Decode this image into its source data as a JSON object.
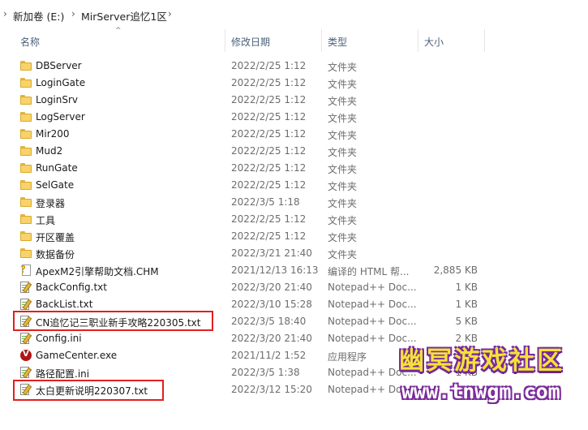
{
  "breadcrumb": {
    "parts": [
      "新加卷 (E:)",
      "MirServer追忆1区"
    ]
  },
  "columns": {
    "name": "名称",
    "date": "修改日期",
    "type": "类型",
    "size": "大小"
  },
  "files": [
    {
      "name": "DBServer",
      "date": "2022/2/25 1:12",
      "type": "文件夹",
      "size": "",
      "icon": "folder-icon"
    },
    {
      "name": "LoginGate",
      "date": "2022/2/25 1:12",
      "type": "文件夹",
      "size": "",
      "icon": "folder-icon"
    },
    {
      "name": "LoginSrv",
      "date": "2022/2/25 1:12",
      "type": "文件夹",
      "size": "",
      "icon": "folder-icon"
    },
    {
      "name": "LogServer",
      "date": "2022/2/25 1:12",
      "type": "文件夹",
      "size": "",
      "icon": "folder-icon"
    },
    {
      "name": "Mir200",
      "date": "2022/2/25 1:12",
      "type": "文件夹",
      "size": "",
      "icon": "folder-icon"
    },
    {
      "name": "Mud2",
      "date": "2022/2/25 1:12",
      "type": "文件夹",
      "size": "",
      "icon": "folder-icon"
    },
    {
      "name": "RunGate",
      "date": "2022/2/25 1:12",
      "type": "文件夹",
      "size": "",
      "icon": "folder-icon"
    },
    {
      "name": "SelGate",
      "date": "2022/2/25 1:12",
      "type": "文件夹",
      "size": "",
      "icon": "folder-icon"
    },
    {
      "name": "登录器",
      "date": "2022/3/5 1:18",
      "type": "文件夹",
      "size": "",
      "icon": "folder-icon"
    },
    {
      "name": "工具",
      "date": "2022/2/25 1:12",
      "type": "文件夹",
      "size": "",
      "icon": "folder-icon"
    },
    {
      "name": "开区覆盖",
      "date": "2022/2/25 1:12",
      "type": "文件夹",
      "size": "",
      "icon": "folder-icon"
    },
    {
      "name": "数据备份",
      "date": "2022/3/21 21:40",
      "type": "文件夹",
      "size": "",
      "icon": "folder-icon"
    },
    {
      "name": "ApexM2引擎帮助文档.CHM",
      "date": "2021/12/13 16:13",
      "type": "编译的 HTML 帮...",
      "size": "2,885 KB",
      "icon": "chm-help-icon"
    },
    {
      "name": "BackConfig.txt",
      "date": "2022/3/20 21:40",
      "type": "Notepad++ Doc...",
      "size": "1 KB",
      "icon": "notepad-document-icon"
    },
    {
      "name": "BackList.txt",
      "date": "2022/3/10 15:28",
      "type": "Notepad++ Doc...",
      "size": "1 KB",
      "icon": "notepad-document-icon"
    },
    {
      "name": "CN追忆记三职业新手攻略220305.txt",
      "date": "2022/3/5 18:40",
      "type": "Notepad++ Doc...",
      "size": "5 KB",
      "icon": "notepad-document-icon"
    },
    {
      "name": "Config.ini",
      "date": "2022/3/20 21:40",
      "type": "Notepad++ Doc...",
      "size": "2 KB",
      "icon": "notepad-document-icon"
    },
    {
      "name": "GameCenter.exe",
      "date": "2021/11/2 1:52",
      "type": "应用程序",
      "size": "",
      "icon": "gamecenter-app-icon"
    },
    {
      "name": "路径配置.ini",
      "date": "2022/3/5 1:38",
      "type": "Notepad++ Doc...",
      "size": "1 KB",
      "icon": "notepad-document-icon"
    },
    {
      "name": "太白更新说明220307.txt",
      "date": "2022/3/12 15:20",
      "type": "Notepad++ Doc...",
      "size": "",
      "icon": "notepad-document-icon"
    }
  ],
  "watermark": {
    "line1": "幽冥游戏社区",
    "line2": "www.tnwgm.com"
  },
  "colors": {
    "highlight_box": "#e02020",
    "folder": "#f8d26a",
    "header_text": "#4c607a"
  }
}
